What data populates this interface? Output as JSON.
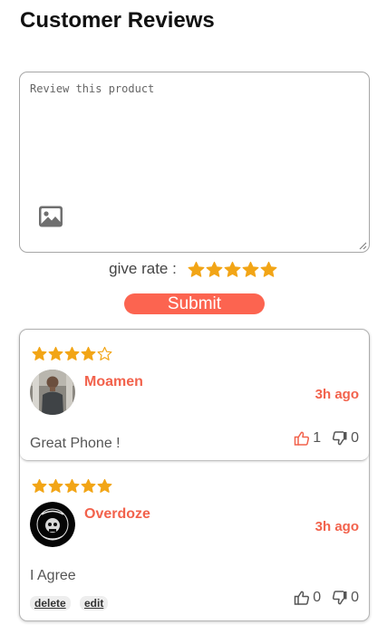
{
  "page": {
    "title": "Customer Reviews"
  },
  "compose": {
    "placeholder": "Review this product",
    "image_icon": "image-icon",
    "rate_label": "give rate :",
    "rating": 5,
    "max_rating": 5,
    "submit_label": "Submit"
  },
  "reviews": [
    {
      "rating": 4,
      "max_rating": 5,
      "username": "Moamen",
      "time": "3h ago",
      "comment": "Great Phone !",
      "likes": "1",
      "dislikes": "0",
      "liked": true
    },
    {
      "rating": 5,
      "max_rating": 5,
      "username": "Overdoze",
      "time": "3h ago",
      "comment": "I Agree",
      "likes": "0",
      "dislikes": "0",
      "liked": false,
      "actions": {
        "delete_label": "delete",
        "edit_label": "edit"
      }
    }
  ],
  "colors": {
    "accent": "#fc6450",
    "username": "#f2624c",
    "star": "#f2a516",
    "liked": "#f2624c"
  }
}
